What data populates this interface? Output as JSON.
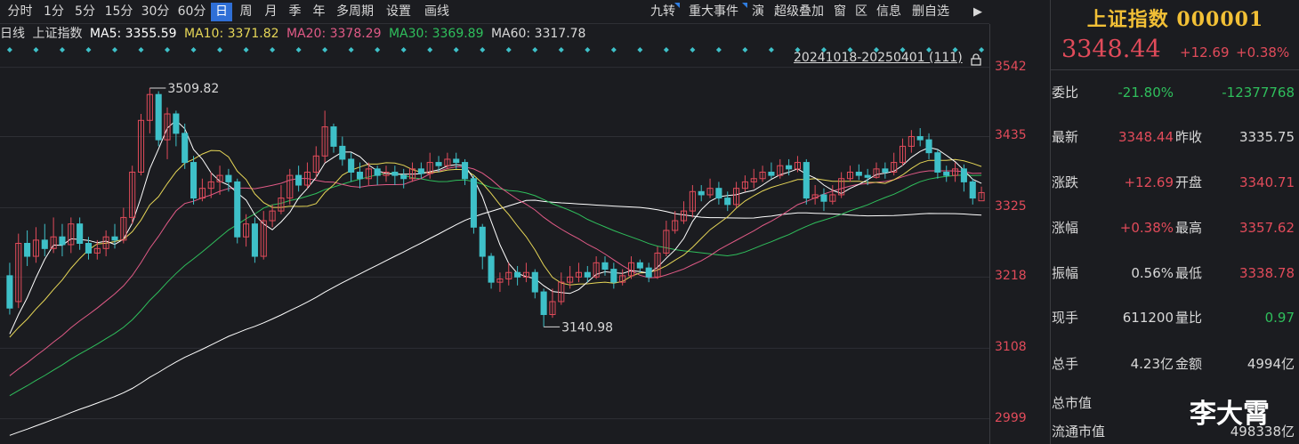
{
  "toolbar": {
    "tabs": [
      "分时",
      "1分",
      "5分",
      "15分",
      "30分",
      "60分",
      "日",
      "周",
      "月",
      "季",
      "年",
      "多周期",
      "设置",
      "画线"
    ],
    "active_tab": "日",
    "right_tabs": [
      "九转",
      "重大事件",
      "演",
      "超级叠加",
      "窗",
      "区",
      "信息",
      "删自选"
    ]
  },
  "legend": {
    "period": "日线",
    "name": "上证指数",
    "ma5": "MA5: 3355.59",
    "ma10": "MA10: 3371.82",
    "ma20": "MA20: 3378.29",
    "ma30": "MA30: 3369.89",
    "ma60": "MA60: 3317.78"
  },
  "colors": {
    "ma5": "#ffffff",
    "ma10": "#e6d657",
    "ma20": "#e05a86",
    "ma30": "#2fbf5c",
    "ma60": "#ffffff",
    "up": "#e14b5a",
    "down": "#3ec0c8",
    "accent": "#2f6fd6"
  },
  "chart_data": {
    "type": "candlestick",
    "range_label": "20241018-20250401 (111)",
    "y_ticks": [
      "3542",
      "3435",
      "3325",
      "3218",
      "3108",
      "2999"
    ],
    "ylim": [
      2960,
      3580
    ],
    "high_annotation": "3509.82",
    "low_annotation": "3140.98",
    "high": 3509.82,
    "low": 3140.98,
    "candles": [
      [
        3220,
        3170,
        3240,
        3160
      ],
      [
        3180,
        3270,
        3285,
        3170
      ],
      [
        3270,
        3250,
        3290,
        3235
      ],
      [
        3250,
        3275,
        3295,
        3240
      ],
      [
        3275,
        3262,
        3300,
        3250
      ],
      [
        3262,
        3280,
        3310,
        3255
      ],
      [
        3280,
        3268,
        3300,
        3250
      ],
      [
        3268,
        3300,
        3310,
        3255
      ],
      [
        3300,
        3270,
        3310,
        3260
      ],
      [
        3270,
        3255,
        3280,
        3245
      ],
      [
        3255,
        3262,
        3275,
        3245
      ],
      [
        3262,
        3280,
        3290,
        3250
      ],
      [
        3280,
        3275,
        3300,
        3262
      ],
      [
        3275,
        3310,
        3325,
        3270
      ],
      [
        3310,
        3380,
        3390,
        3300
      ],
      [
        3380,
        3460,
        3470,
        3375
      ],
      [
        3460,
        3500,
        3509.82,
        3440
      ],
      [
        3500,
        3430,
        3505,
        3420
      ],
      [
        3430,
        3470,
        3480,
        3400
      ],
      [
        3470,
        3440,
        3475,
        3420
      ],
      [
        3440,
        3395,
        3455,
        3385
      ],
      [
        3395,
        3340,
        3405,
        3330
      ],
      [
        3340,
        3355,
        3370,
        3335
      ],
      [
        3355,
        3365,
        3380,
        3340
      ],
      [
        3365,
        3375,
        3390,
        3345
      ],
      [
        3375,
        3365,
        3385,
        3350
      ],
      [
        3365,
        3280,
        3370,
        3270
      ],
      [
        3280,
        3300,
        3315,
        3265
      ],
      [
        3300,
        3250,
        3310,
        3240
      ],
      [
        3250,
        3305,
        3320,
        3245
      ],
      [
        3305,
        3320,
        3330,
        3295
      ],
      [
        3320,
        3340,
        3360,
        3315
      ],
      [
        3340,
        3375,
        3385,
        3330
      ],
      [
        3375,
        3360,
        3390,
        3350
      ],
      [
        3360,
        3380,
        3395,
        3355
      ],
      [
        3380,
        3405,
        3420,
        3370
      ],
      [
        3405,
        3450,
        3475,
        3395
      ],
      [
        3450,
        3420,
        3455,
        3410
      ],
      [
        3420,
        3400,
        3435,
        3390
      ],
      [
        3400,
        3380,
        3410,
        3365
      ],
      [
        3380,
        3370,
        3395,
        3355
      ],
      [
        3370,
        3385,
        3395,
        3360
      ],
      [
        3385,
        3375,
        3390,
        3360
      ],
      [
        3375,
        3380,
        3390,
        3365
      ],
      [
        3380,
        3375,
        3390,
        3360
      ],
      [
        3375,
        3370,
        3385,
        3355
      ],
      [
        3370,
        3385,
        3395,
        3365
      ],
      [
        3385,
        3378,
        3395,
        3370
      ],
      [
        3378,
        3395,
        3410,
        3370
      ],
      [
        3395,
        3390,
        3405,
        3380
      ],
      [
        3390,
        3400,
        3410,
        3385
      ],
      [
        3400,
        3395,
        3410,
        3385
      ],
      [
        3395,
        3370,
        3400,
        3360
      ],
      [
        3370,
        3295,
        3375,
        3285
      ],
      [
        3295,
        3250,
        3300,
        3230
      ],
      [
        3250,
        3210,
        3255,
        3200
      ],
      [
        3210,
        3215,
        3225,
        3195
      ],
      [
        3215,
        3225,
        3240,
        3205
      ],
      [
        3225,
        3218,
        3235,
        3205
      ],
      [
        3218,
        3225,
        3240,
        3210
      ],
      [
        3225,
        3195,
        3230,
        3185
      ],
      [
        3195,
        3160,
        3200,
        3140.98
      ],
      [
        3160,
        3180,
        3200,
        3155
      ],
      [
        3180,
        3210,
        3225,
        3175
      ],
      [
        3210,
        3218,
        3235,
        3200
      ],
      [
        3218,
        3225,
        3240,
        3210
      ],
      [
        3225,
        3218,
        3235,
        3210
      ],
      [
        3218,
        3240,
        3250,
        3215
      ],
      [
        3240,
        3230,
        3250,
        3220
      ],
      [
        3230,
        3210,
        3240,
        3200
      ],
      [
        3210,
        3220,
        3230,
        3205
      ],
      [
        3220,
        3240,
        3250,
        3215
      ],
      [
        3240,
        3232,
        3245,
        3225
      ],
      [
        3232,
        3218,
        3240,
        3210
      ],
      [
        3218,
        3255,
        3265,
        3215
      ],
      [
        3255,
        3290,
        3305,
        3250
      ],
      [
        3290,
        3305,
        3320,
        3285
      ],
      [
        3305,
        3320,
        3335,
        3300
      ],
      [
        3320,
        3350,
        3360,
        3310
      ],
      [
        3350,
        3345,
        3360,
        3335
      ],
      [
        3345,
        3355,
        3370,
        3340
      ],
      [
        3355,
        3340,
        3365,
        3330
      ],
      [
        3340,
        3330,
        3350,
        3320
      ],
      [
        3330,
        3355,
        3365,
        3325
      ],
      [
        3355,
        3365,
        3375,
        3350
      ],
      [
        3365,
        3370,
        3385,
        3355
      ],
      [
        3370,
        3380,
        3390,
        3365
      ],
      [
        3380,
        3375,
        3395,
        3370
      ],
      [
        3375,
        3390,
        3400,
        3370
      ],
      [
        3390,
        3385,
        3400,
        3375
      ],
      [
        3385,
        3395,
        3405,
        3380
      ],
      [
        3395,
        3340,
        3400,
        3330
      ],
      [
        3340,
        3345,
        3360,
        3330
      ],
      [
        3345,
        3335,
        3355,
        3320
      ],
      [
        3335,
        3345,
        3360,
        3330
      ],
      [
        3345,
        3370,
        3380,
        3340
      ],
      [
        3370,
        3380,
        3390,
        3365
      ],
      [
        3380,
        3375,
        3392,
        3368
      ],
      [
        3375,
        3372,
        3385,
        3360
      ],
      [
        3372,
        3385,
        3395,
        3370
      ],
      [
        3385,
        3380,
        3395,
        3370
      ],
      [
        3380,
        3395,
        3410,
        3375
      ],
      [
        3395,
        3420,
        3432,
        3390
      ],
      [
        3420,
        3435,
        3445,
        3410
      ],
      [
        3435,
        3430,
        3448,
        3420
      ],
      [
        3430,
        3410,
        3440,
        3400
      ],
      [
        3410,
        3380,
        3415,
        3370
      ],
      [
        3380,
        3375,
        3390,
        3365
      ],
      [
        3375,
        3385,
        3395,
        3365
      ],
      [
        3385,
        3365,
        3392,
        3350
      ],
      [
        3365,
        3340,
        3370,
        3330
      ],
      [
        3335.75,
        3348.44,
        3357.62,
        3338.78
      ]
    ]
  },
  "panel": {
    "title": "上证指数 000001",
    "price": "3348.44",
    "change": "+12.69",
    "change_pct": "+0.38%",
    "rows": [
      {
        "l1": "委比",
        "v1": "-21.80%",
        "l2": "",
        "v2": "-12377768",
        "c1": "green",
        "c2": "green"
      },
      {
        "l1": "最新",
        "v1": "3348.44",
        "l2": "昨收",
        "v2": "3335.75",
        "c1": "red",
        "c2": "white"
      },
      {
        "l1": "涨跌",
        "v1": "+12.69",
        "l2": "开盘",
        "v2": "3340.71",
        "c1": "red",
        "c2": "red"
      },
      {
        "l1": "涨幅",
        "v1": "+0.38%",
        "l2": "最高",
        "v2": "3357.62",
        "c1": "red",
        "c2": "red"
      },
      {
        "l1": "振幅",
        "v1": "0.56%",
        "l2": "最低",
        "v2": "3338.78",
        "c1": "white",
        "c2": "red"
      },
      {
        "l1": "现手",
        "v1": "611200",
        "l2": "量比",
        "v2": "0.97",
        "c1": "white",
        "c2": "green"
      },
      {
        "l1": "总手",
        "v1": "4.23亿",
        "l2": "金额",
        "v2": "4994亿",
        "c1": "white",
        "c2": "white"
      },
      {
        "l1": "总市值",
        "v1": "",
        "l2": "",
        "v2": "",
        "c1": "white",
        "c2": "white"
      },
      {
        "l1": "流通市值",
        "v1": "",
        "l2": "",
        "v2": "498338亿",
        "c1": "white",
        "c2": "white"
      }
    ]
  },
  "watermark": "李大霄"
}
